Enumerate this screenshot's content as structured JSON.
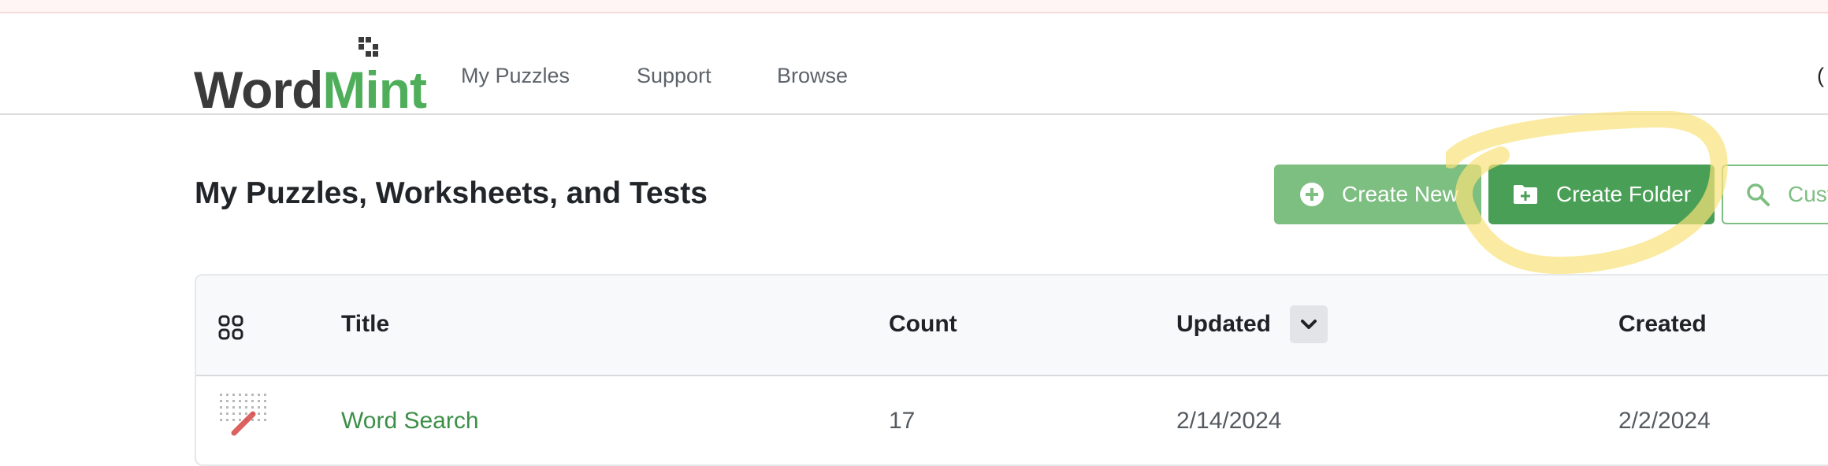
{
  "brand": {
    "logo_part1": "Word",
    "logo_part2": "Mint",
    "colors": {
      "dark": "#3a3a3a",
      "mint": "#4fae5a",
      "primary_button": "#4a9f56",
      "light_button": "#7dbe81",
      "highlight": "#f9e27a",
      "link": "#3c8f47"
    }
  },
  "nav": {
    "items": [
      {
        "label": "My Puzzles"
      },
      {
        "label": "Support"
      },
      {
        "label": "Browse"
      }
    ],
    "right_edge_glyph": "("
  },
  "page": {
    "title": "My Puzzles, Worksheets, and Tests"
  },
  "actions": {
    "create_new": {
      "label": "Create New",
      "icon": "plus-circle-icon"
    },
    "create_folder": {
      "label": "Create Folder",
      "icon": "folder-plus-icon"
    },
    "custom": {
      "label": "Cust",
      "icon": "search-icon"
    }
  },
  "table": {
    "view_icon": "grid-view-icon",
    "columns": {
      "title": "Title",
      "count": "Count",
      "updated": "Updated",
      "created": "Created"
    },
    "sort_icon": "chevron-down-icon",
    "rows": [
      {
        "title": "Word Search",
        "count": "17",
        "updated": "2/14/2024",
        "created": "2/2/2024",
        "thumb": "word-search-thumbnail"
      }
    ]
  }
}
